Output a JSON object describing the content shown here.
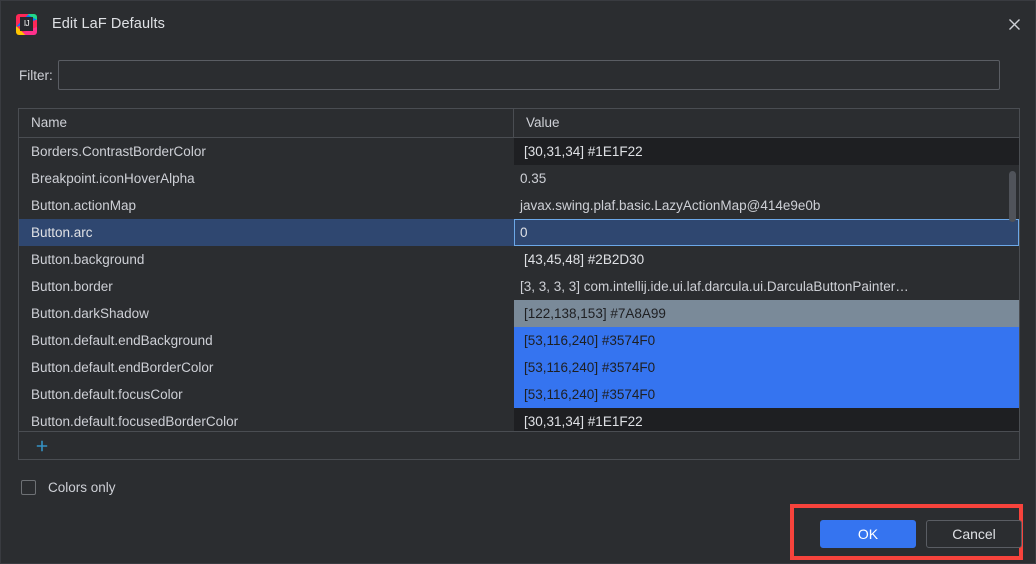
{
  "window": {
    "title": "Edit LaF Defaults",
    "app_icon": "intellij-idea-logo",
    "close_icon": "close-icon"
  },
  "filter": {
    "label": "Filter:",
    "value": "",
    "placeholder": ""
  },
  "table": {
    "columns": [
      "Name",
      "Value"
    ],
    "rows": [
      {
        "name": "Borders.ContrastBorderColor",
        "value": "[30,31,34] #1E1F22",
        "swatch": "#1e1f22",
        "swatch_text": "light",
        "selected": false
      },
      {
        "name": "Breakpoint.iconHoverAlpha",
        "value": "0.35",
        "swatch": "",
        "swatch_text": "",
        "selected": false
      },
      {
        "name": "Button.actionMap",
        "value": "javax.swing.plaf.basic.LazyActionMap@414e9e0b",
        "swatch": "",
        "swatch_text": "",
        "selected": false
      },
      {
        "name": "Button.arc",
        "value": "0",
        "swatch": "",
        "swatch_text": "",
        "selected": true
      },
      {
        "name": "Button.background",
        "value": "[43,45,48] #2B2D30",
        "swatch": "#2b2d30",
        "swatch_text": "light",
        "selected": false
      },
      {
        "name": "Button.border",
        "value": "[3, 3, 3, 3] com.intellij.ide.ui.laf.darcula.ui.DarculaButtonPainter…",
        "swatch": "",
        "swatch_text": "",
        "selected": false
      },
      {
        "name": "Button.darkShadow",
        "value": "[122,138,153] #7A8A99",
        "swatch": "#7a8a99",
        "swatch_text": "dark",
        "selected": false
      },
      {
        "name": "Button.default.endBackground",
        "value": "[53,116,240] #3574F0",
        "swatch": "#3574f0",
        "swatch_text": "dark",
        "selected": false
      },
      {
        "name": "Button.default.endBorderColor",
        "value": "[53,116,240] #3574F0",
        "swatch": "#3574f0",
        "swatch_text": "dark",
        "selected": false
      },
      {
        "name": "Button.default.focusColor",
        "value": "[53,116,240] #3574F0",
        "swatch": "#3574f0",
        "swatch_text": "dark",
        "selected": false
      },
      {
        "name": "Button.default.focusedBorderColor",
        "value": "[30,31,34] #1E1F22",
        "swatch": "#1e1f22",
        "swatch_text": "light",
        "selected": false
      }
    ],
    "add_button_icon": "plus-icon"
  },
  "options": {
    "colors_only_label": "Colors only",
    "colors_only_checked": false
  },
  "footer": {
    "ok_label": "OK",
    "cancel_label": "Cancel"
  },
  "annotation": {
    "color": "#F7433C"
  },
  "colors": {
    "dialog_background": "#2B2D30",
    "selection": "#2F4770",
    "accent": "#3574F0",
    "add_icon": "#3592C4"
  }
}
